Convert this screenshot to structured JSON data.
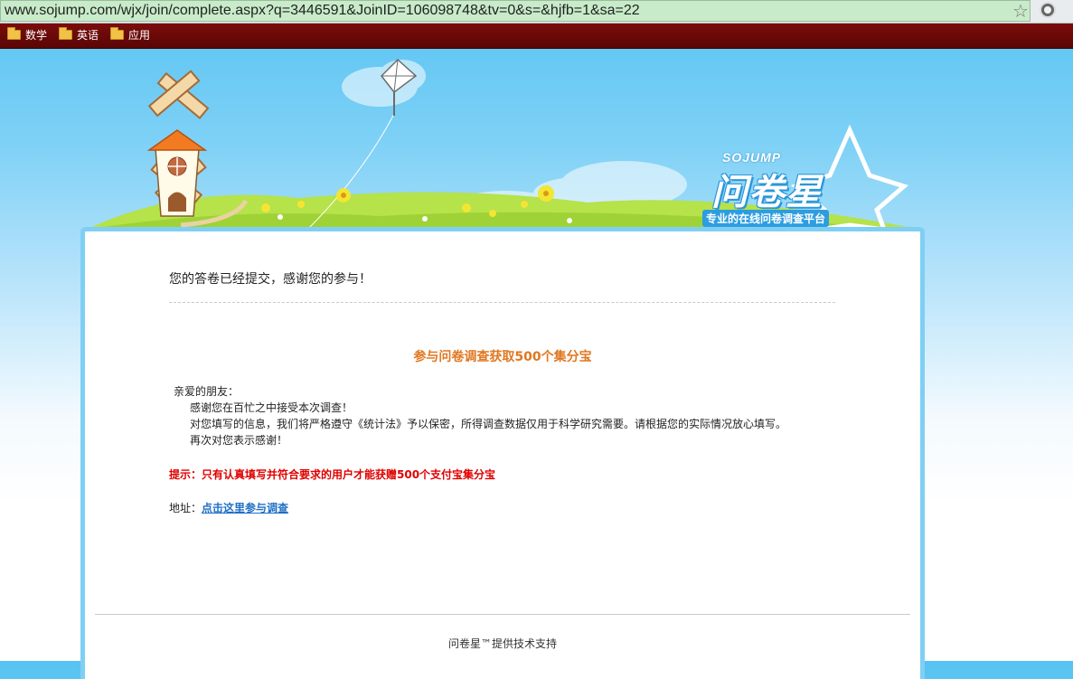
{
  "browser": {
    "url": "www.sojump.com/wjx/join/complete.aspx?q=3446591&JoinID=106098748&tv=0&s=&hjfb=1&sa=22",
    "bookmarks": [
      {
        "label": "数学",
        "icon": "folder-icon"
      },
      {
        "label": "英语",
        "icon": "folder-icon"
      },
      {
        "label": "应用",
        "icon": "folder-icon"
      }
    ]
  },
  "brand": {
    "logo_en": "SOJUMP",
    "logo_cn": "问卷星",
    "slogan": "专业的在线问卷调查平台"
  },
  "content": {
    "submitted_msg": "您的答卷已经提交，感谢您的参与！",
    "promo_title": "参与问卷调查获取500个集分宝",
    "greeting": "亲爱的朋友：",
    "line1": "感谢您在百忙之中接受本次调查！",
    "line2": "对您填写的信息，我们将严格遵守《统计法》予以保密，所得调查数据仅用于科学研究需要。请根据您的实际情况放心填写。",
    "line3": "再次对您表示感谢！",
    "tip": "提示：只有认真填写并符合要求的用户才能获赠500个支付宝集分宝",
    "address_label": "地址：",
    "address_link": "点击这里参与调查",
    "footer": "问卷星™提供技术支持"
  },
  "colors": {
    "sky_top": "#57c3f2",
    "card_border": "#7fcff5",
    "promo_orange": "#e0771f",
    "tip_red": "#e00000",
    "link_blue": "#1f6fc5",
    "url_bar_green": "#c8ebc9",
    "bookmark_bar": "#6b0908"
  }
}
